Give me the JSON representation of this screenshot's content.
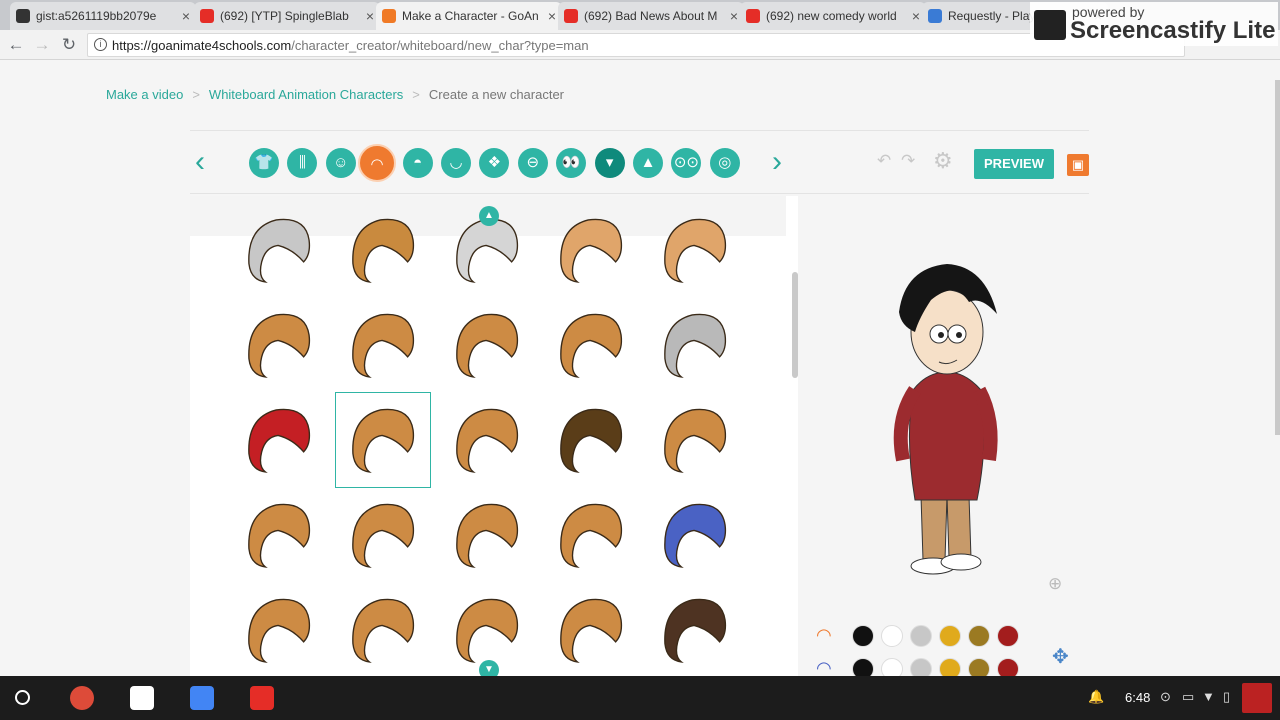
{
  "browser": {
    "tabs": [
      {
        "title": "gist:a5261119bb2079e",
        "fav": "github",
        "color": "#333333"
      },
      {
        "title": "(692) [YTP] SpingleBlab",
        "fav": "youtube",
        "color": "#e52d27"
      },
      {
        "title": "Make a Character - GoAn",
        "fav": "goanimate",
        "color": "#f07a26"
      },
      {
        "title": "(692) Bad News About M",
        "fav": "youtube",
        "color": "#e52d27"
      },
      {
        "title": "(692) new comedy world",
        "fav": "youtube",
        "color": "#e52d27"
      },
      {
        "title": "Requestly - Play",
        "fav": "requestly",
        "color": "#3a7bd5"
      }
    ],
    "url_domain": "https://goanimate4schools.com",
    "url_path": "/character_creator/whiteboard/new_char?type=man"
  },
  "watermark": {
    "line1": "powered by",
    "line2": "Screencastify Lite"
  },
  "breadcrumb": {
    "items": [
      "Make a video",
      "Whiteboard Animation Characters"
    ],
    "current": "Create a new character"
  },
  "toolbar": {
    "categories": [
      {
        "icon": "shirt-icon",
        "glyph": "👕"
      },
      {
        "icon": "pants-icon",
        "glyph": "⫼"
      },
      {
        "icon": "face-icon",
        "glyph": "☺"
      },
      {
        "icon": "hair-icon",
        "glyph": "◠",
        "selected": true
      },
      {
        "icon": "eyebrow-icon",
        "glyph": "◓"
      },
      {
        "icon": "mouth-icon",
        "glyph": "◡"
      },
      {
        "icon": "nose-icon",
        "glyph": "❖"
      },
      {
        "icon": "ear-icon",
        "glyph": "⊖"
      },
      {
        "icon": "eyes-icon",
        "glyph": "👀"
      },
      {
        "icon": "facial-hair-icon",
        "glyph": "▾",
        "dark": true
      },
      {
        "icon": "hat-icon",
        "glyph": "▲"
      },
      {
        "icon": "glasses-icon",
        "glyph": "⊙⊙"
      },
      {
        "icon": "accessory-icon",
        "glyph": "◎"
      }
    ],
    "preview": "PREVIEW"
  },
  "hair_grid": {
    "colors": [
      [
        "#c7c7c7",
        "#c98a3e",
        "#d5d5d5",
        "#e0a56a",
        "#e0a56a"
      ],
      [
        "#cd8b44",
        "#cd8b44",
        "#cd8b44",
        "#cd8b44",
        "#b9b9b9"
      ],
      [
        "#c41f24",
        "#cd8b44",
        "#cd8b44",
        "#5a3d18",
        "#cd8b44"
      ],
      [
        "#cd8b44",
        "#cd8b44",
        "#cd8b44",
        "#cd8b44",
        "#4a62c4"
      ],
      [
        "#cd8b44",
        "#cd8b44",
        "#cd8b44",
        "#cd8b44",
        "#4e3322"
      ]
    ],
    "selected": [
      2,
      1
    ]
  },
  "swatches": {
    "row1": [
      "#111111",
      "#ffffff",
      "#c7c7c7",
      "#e0aa1c",
      "#9b7a22",
      "#a31d1d"
    ]
  },
  "taskbar": {
    "time": "6:48",
    "apps": [
      "chrome-icon",
      "gmail-icon",
      "docs-icon",
      "youtube-icon"
    ]
  }
}
